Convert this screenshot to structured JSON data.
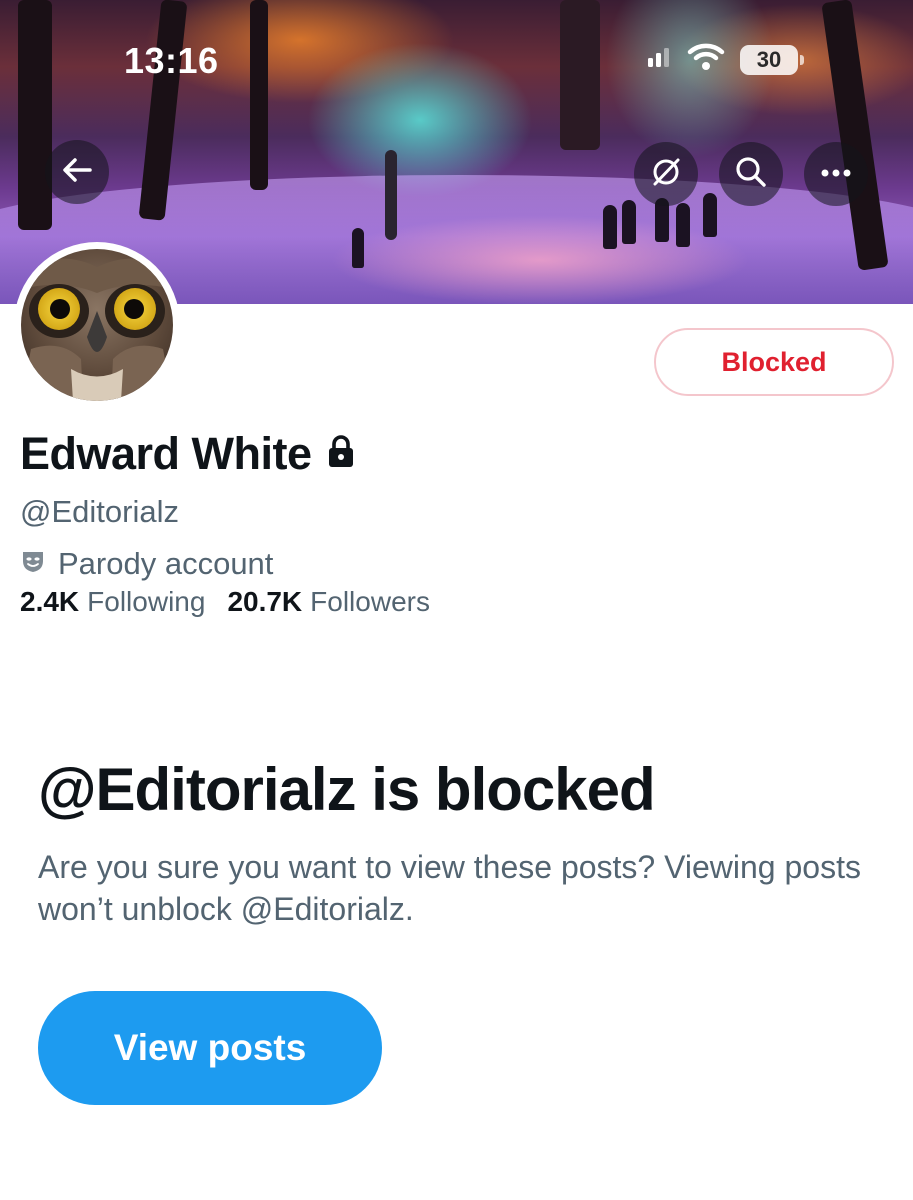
{
  "status_bar": {
    "time": "13:16",
    "battery": "30"
  },
  "header": {
    "back_icon": "arrow-left-icon",
    "actions": [
      "link-off-icon",
      "search-icon",
      "more-icon"
    ]
  },
  "profile": {
    "name": "Edward White",
    "locked_icon": "lock-icon",
    "handle": "@Editorialz",
    "parody_label": "Parody account",
    "following_count": "2.4K",
    "following_label": "Following",
    "followers_count": "20.7K",
    "followers_label": "Followers",
    "relationship_button": "Blocked"
  },
  "blocked_notice": {
    "title": "@Editorialz is blocked",
    "description": "Are you sure you want to view these posts? Viewing posts won’t unblock @Editorialz.",
    "button_label": "View posts"
  },
  "colors": {
    "accent": "#1d9bf0",
    "blocked_text": "#e0202f",
    "blocked_border": "#f4c6cc",
    "secondary_text": "#536471",
    "primary_text": "#0f1419"
  }
}
